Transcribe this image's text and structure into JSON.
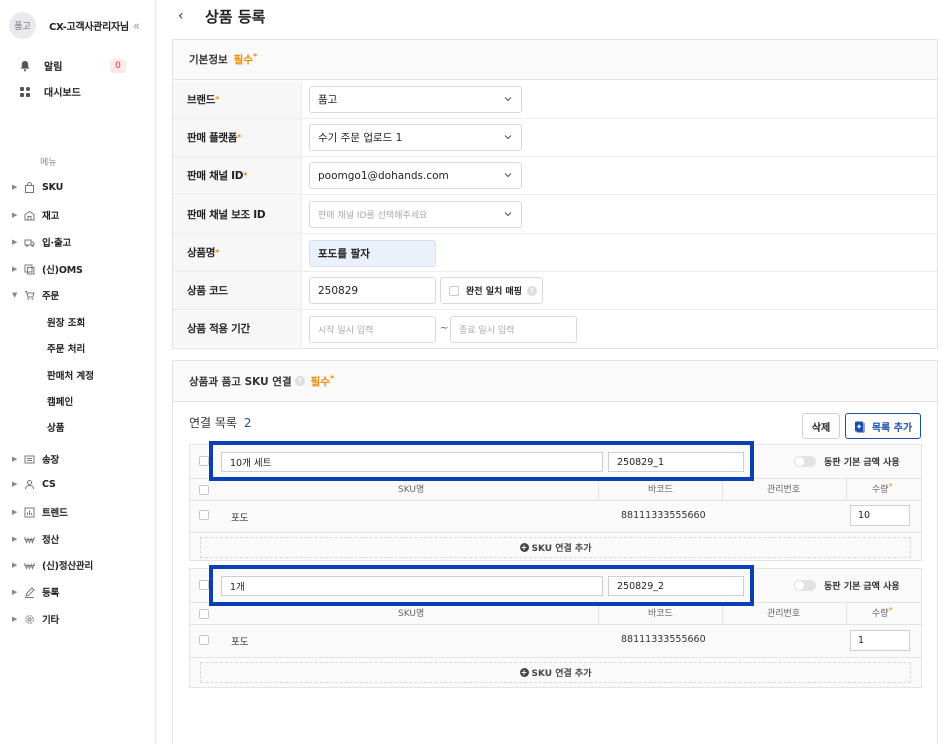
{
  "sidebar": {
    "avatar": "품고",
    "user_name": "CX-고객사관리자님",
    "collapse_icon": "«",
    "top_items": [
      {
        "label": "알림",
        "icon": "bell-icon",
        "badge": "0"
      },
      {
        "label": "대시보드",
        "icon": "dashboard-icon"
      }
    ],
    "menu_label": "메뉴",
    "nav": [
      {
        "label": "SKU",
        "icon": "bag-icon"
      },
      {
        "label": "재고",
        "icon": "warehouse-icon"
      },
      {
        "label": "입·출고",
        "icon": "truck-icon"
      },
      {
        "label": "(신)OMS",
        "icon": "oms-icon"
      },
      {
        "label": "주문",
        "icon": "cart-icon"
      },
      {
        "label": "송장",
        "icon": "invoice-icon"
      },
      {
        "label": "CS",
        "icon": "person-icon"
      },
      {
        "label": "트렌드",
        "icon": "chart-icon"
      },
      {
        "label": "정산",
        "icon": "won-icon"
      },
      {
        "label": "(신)정산관리",
        "icon": "won-icon"
      },
      {
        "label": "등록",
        "icon": "pencil-icon"
      },
      {
        "label": "기타",
        "icon": "gear-icon"
      }
    ],
    "order_sub": [
      "원장 조회",
      "주문 처리",
      "판매처 계정",
      "캠페인",
      "상품"
    ]
  },
  "header": {
    "title": "상품 등록",
    "back_icon": "‹"
  },
  "basic": {
    "title": "기본정보",
    "required": "필수",
    "rows": {
      "brand": {
        "label": "브랜드",
        "value": "품고"
      },
      "platform": {
        "label": "판매 플랫폼",
        "value": "수기 주문 업로드 1"
      },
      "channel": {
        "label": "판매 채널 ID",
        "value": "poomgo1@dohands.com"
      },
      "sub_channel": {
        "label": "판매 채널 보조 ID",
        "placeholder": "판매 채널 ID를 선택해주세요"
      },
      "name": {
        "label": "상품명",
        "value": "포도를 팔자"
      },
      "code": {
        "label": "상품 코드",
        "value": "250829",
        "exact_match": "완전 일치 매핑"
      },
      "period": {
        "label": "상품 적용 기간",
        "start_placeholder": "시작 일시 입력",
        "separator": "~",
        "end_placeholder": "종료 일시 입력"
      }
    }
  },
  "link": {
    "title": "상품과 품고 SKU 연결",
    "required": "필수",
    "list_label": "연결 목록",
    "count": "2",
    "delete_btn": "삭제",
    "add_btn": "목록 추가",
    "columns": [
      "SKU명",
      "바코드",
      "관리번호",
      "수량"
    ],
    "toggle_label": "동판 기본 금액 사용",
    "add_sku": "SKU 연결 추가",
    "groups": [
      {
        "name": "10개 세트",
        "code": "250829_1",
        "rows": [
          {
            "sku": "포도",
            "barcode": "88111333555660",
            "manage": "",
            "qty": "10"
          }
        ]
      },
      {
        "name": "1개",
        "code": "250829_2",
        "rows": [
          {
            "sku": "포도",
            "barcode": "88111333555660",
            "manage": "",
            "qty": "1"
          }
        ]
      }
    ]
  },
  "colors": {
    "accent": "#1a4fb0",
    "required": "#f08a00",
    "highlight": "#0b3fb5"
  }
}
